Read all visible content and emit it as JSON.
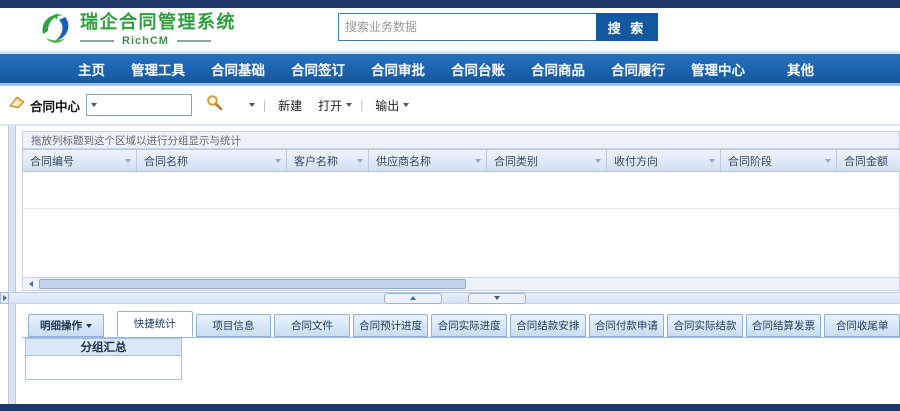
{
  "colors": {
    "top_bar": "#1c3967",
    "nav_bar": "#1e64b0",
    "search_button_bg": "#11589e",
    "logo_green": "#2f9e3c",
    "panel_light_blue": "#d9e7f7",
    "grid_border": "#b9c9e2"
  },
  "header": {
    "logo_title": "瑞企合同管理系统",
    "logo_subtitle": "RichCM",
    "search_placeholder": "搜索业务数据",
    "search_button_label": "搜 索"
  },
  "nav": {
    "items": [
      "主页",
      "管理工具",
      "合同基础",
      "合同签订",
      "合同审批",
      "合同台账",
      "合同商品",
      "合同履行",
      "管理中心",
      "其他"
    ]
  },
  "toolbar": {
    "module_label": "合同中心",
    "combo_value": "",
    "new_label": "新建",
    "open_label": "打开",
    "export_label": "输出",
    "separator": "|"
  },
  "grid": {
    "group_hint": "拖放列标题到这个区域以进行分组显示与统计",
    "columns": [
      "合同编号",
      "合同名称",
      "客户名称",
      "供应商名称",
      "合同类别",
      "收付方向",
      "合同阶段",
      "合同金额"
    ]
  },
  "bottom_tabs": {
    "detail_button_label": "明细操作",
    "active_tab": "快捷统计",
    "tabs": [
      "快捷统计",
      "项目信息",
      "合同文件",
      "合同预计进度",
      "合同实际进度",
      "合同结款安排",
      "合同付款申请",
      "合同实际结款",
      "合同结算发票",
      "合同收尾单"
    ]
  },
  "group_summary": {
    "title": "分组汇总"
  }
}
